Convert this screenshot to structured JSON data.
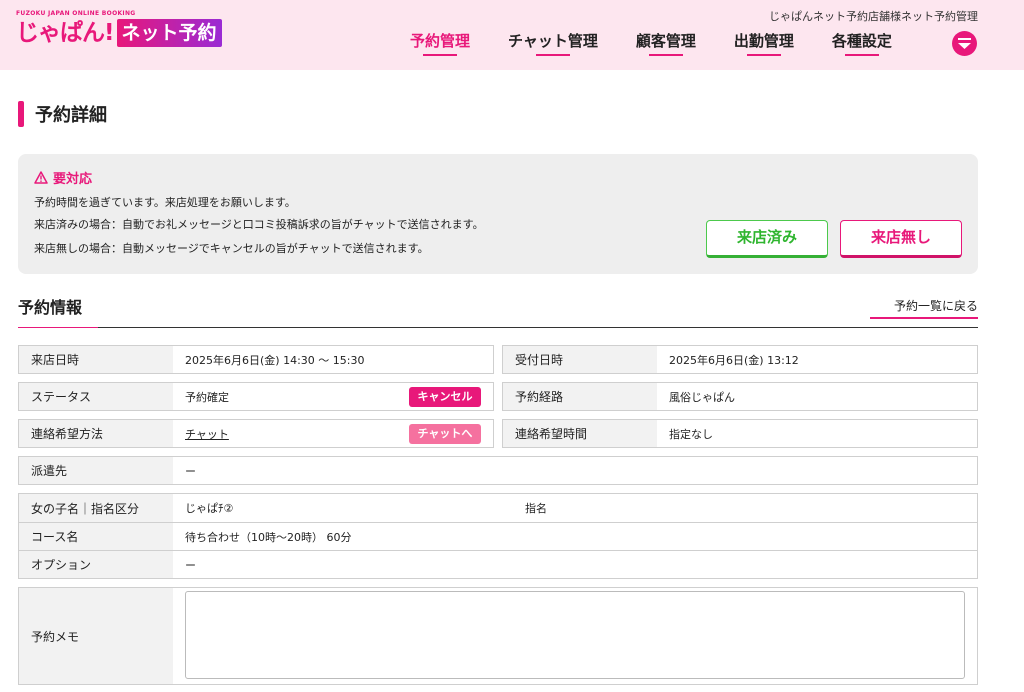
{
  "header": {
    "logo_top": "FUZOKU JAPAN ONLINE BOOKING",
    "logo_main": "じゃぱん!",
    "logo_badge": "ネット予約",
    "subtitle": "じゃぱんネット予約店舗様ネット予約管理",
    "nav": [
      {
        "label": "予約管理",
        "active": true
      },
      {
        "label": "チャット管理",
        "active": false
      },
      {
        "label": "顧客管理",
        "active": false
      },
      {
        "label": "出勤管理",
        "active": false
      },
      {
        "label": "各種設定",
        "active": false
      }
    ]
  },
  "page": {
    "title": "予約詳細"
  },
  "alert": {
    "heading": "要対応",
    "line1": "予約時間を過ぎています。来店処理をお願いします。",
    "line2": "来店済みの場合：自動でお礼メッセージと口コミ投稿訴求の旨がチャットで送信されます。",
    "line3": "来店無しの場合：自動メッセージでキャンセルの旨がチャットで送信されます。",
    "visited_button": "来店済み",
    "no_visit_button": "来店無し"
  },
  "section": {
    "title": "予約情報",
    "back_link": "予約一覧に戻る"
  },
  "info": {
    "visit_datetime_label": "来店日時",
    "visit_datetime_value": "2025年6月6日(金) 14:30 〜 15:30",
    "received_label": "受付日時",
    "received_value": "2025年6月6日(金) 13:12",
    "status_label": "ステータス",
    "status_value": "予約確定",
    "cancel_button": "キャンセル",
    "route_label": "予約経路",
    "route_value": "風俗じゃぱん",
    "contact_method_label": "連絡希望方法",
    "contact_method_value": "チャット",
    "chat_button": "チャットへ",
    "contact_time_label": "連絡希望時間",
    "contact_time_value": "指定なし",
    "dispatch_label": "派遣先",
    "dispatch_value": "ー",
    "girl_label": "女の子名｜指名区分",
    "girl_value": "じゃぱﾁ②",
    "nomination_value": "指名",
    "course_label": "コース名",
    "course_value": "待ち合わせ（10時〜20時） 60分",
    "option_label": "オプション",
    "option_value": "ー",
    "memo_label": "予約メモ",
    "memo_value": ""
  },
  "colors": {
    "accent": "#e8187a",
    "header_bg": "#fde6ef",
    "visited_green": "#2fb52f",
    "alert_bg": "#eeeeee"
  }
}
